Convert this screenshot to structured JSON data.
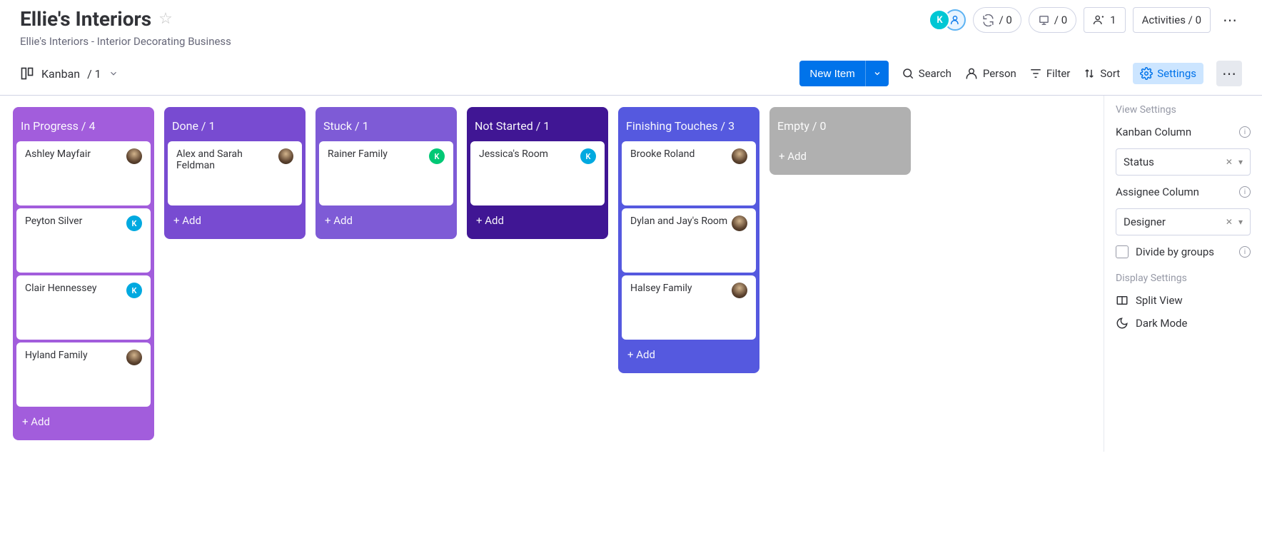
{
  "header": {
    "title": "Ellie's Interiors",
    "subtitle": "Ellie's Interiors - Interior Decorating Business",
    "avatar_letter": "K",
    "counters": {
      "automation": "/ 0",
      "integrations": "/ 0",
      "members_count": "1",
      "activities": "Activities / 0"
    }
  },
  "view": {
    "name": "Kanban",
    "count": "/ 1"
  },
  "toolbar": {
    "new_item": "New Item",
    "search": "Search",
    "person": "Person",
    "filter": "Filter",
    "sort": "Sort",
    "settings": "Settings"
  },
  "columns": [
    {
      "label": "In Progress / 4",
      "color": "#a25ddc",
      "cards": [
        {
          "title": "Ashley Mayfair",
          "avatar": "img"
        },
        {
          "title": "Peyton Silver",
          "avatar": "K",
          "avatar_color": "#00a9e0"
        },
        {
          "title": "Clair Hennessey",
          "avatar": "K",
          "avatar_color": "#00a9e0"
        },
        {
          "title": "Hyland Family",
          "avatar": "img"
        }
      ],
      "add": "+ Add"
    },
    {
      "label": "Done / 1",
      "color": "#784bd1",
      "cards": [
        {
          "title": "Alex and Sarah Feldman",
          "avatar": "img"
        }
      ],
      "add": "+ Add"
    },
    {
      "label": "Stuck / 1",
      "color": "#7e5bd6",
      "cards": [
        {
          "title": "Rainer Family",
          "avatar": "K",
          "avatar_color": "#00c875"
        }
      ],
      "add": "+ Add"
    },
    {
      "label": "Not Started / 1",
      "color": "#401694",
      "cards": [
        {
          "title": "Jessica's Room",
          "avatar": "K",
          "avatar_color": "#00a9e0"
        }
      ],
      "add": "+ Add"
    },
    {
      "label": "Finishing Touches / 3",
      "color": "#5559df",
      "cards": [
        {
          "title": "Brooke Roland",
          "avatar": "img"
        },
        {
          "title": "Dylan and Jay's Room",
          "avatar": "img"
        },
        {
          "title": "Halsey Family",
          "avatar": "img"
        }
      ],
      "add": "+ Add"
    },
    {
      "label": "Empty / 0",
      "color": "#b0b0b0",
      "cards": [],
      "add": "+ Add"
    }
  ],
  "panel": {
    "view_settings": "View Settings",
    "kanban_column": "Kanban Column",
    "kanban_value": "Status",
    "assignee_column": "Assignee Column",
    "assignee_value": "Designer",
    "divide": "Divide by groups",
    "display_settings": "Display Settings",
    "split_view": "Split View",
    "dark_mode": "Dark Mode"
  }
}
